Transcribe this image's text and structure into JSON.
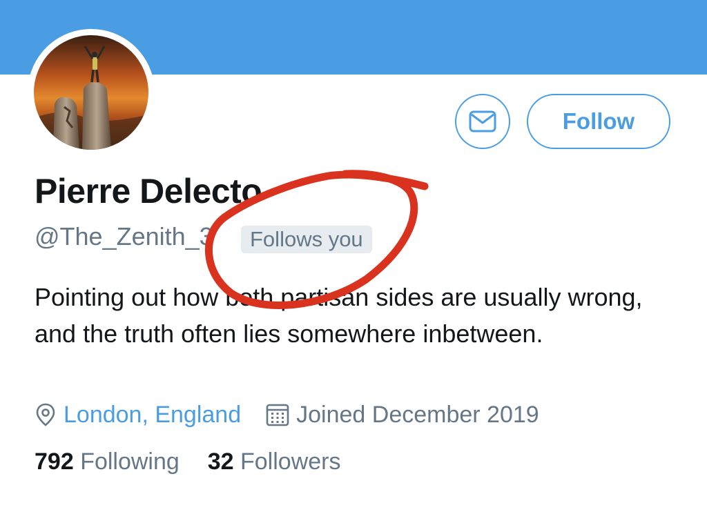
{
  "profile": {
    "follow_label": "Follow",
    "message_icon": "mail-icon",
    "name": "Pierre Delecto",
    "handle": "@The_Zenith_3",
    "follows_you": "Follows you",
    "bio": "Pointing out how both partisan sides are usually wrong, and the truth often lies somewhere inbetween.",
    "location": "London, England",
    "location_icon": "map-pin-icon",
    "joined": "Joined December 2019",
    "joined_icon": "calendar-icon",
    "following_count": "792",
    "following_label": "Following",
    "followers_count": "32",
    "followers_label": "Followers"
  },
  "colors": {
    "accent": "#4a9de3",
    "annotation": "#d9321f",
    "secondary_text": "#657786",
    "primary_text": "#14171a"
  }
}
